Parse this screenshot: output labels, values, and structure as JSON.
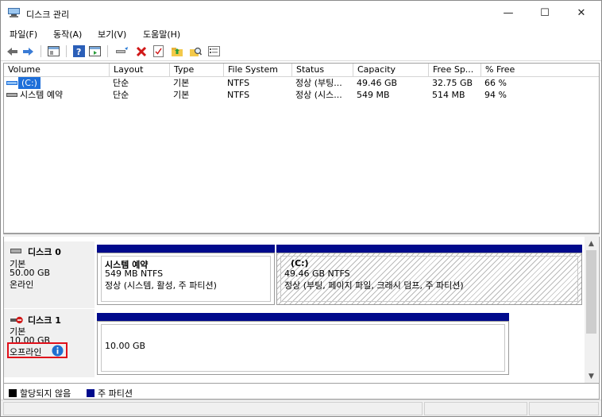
{
  "window": {
    "title": "디스크 관리",
    "minimize_glyph": "—",
    "maximize_glyph": "☐",
    "close_glyph": "✕"
  },
  "menu": [
    "파일(F)",
    "동작(A)",
    "보기(V)",
    "도움말(H)"
  ],
  "toolbar_icons": [
    "back-icon",
    "forward-icon",
    "console-tree-icon",
    "help-icon",
    "show-hide-icon",
    "connect-icon",
    "delete-icon",
    "checklist-icon",
    "folder-up-icon",
    "search-icon",
    "properties-icon"
  ],
  "volume_list": {
    "columns": [
      "Volume",
      "Layout",
      "Type",
      "File System",
      "Status",
      "Capacity",
      "Free Sp...",
      "% Free"
    ],
    "rows": [
      {
        "volume": "(C:)",
        "layout": "단순",
        "type": "기본",
        "fs": "NTFS",
        "status": "정상 (부팅...",
        "capacity": "49.46 GB",
        "free": "32.75 GB",
        "pct": "66 %"
      },
      {
        "volume": "시스템 예약",
        "layout": "단순",
        "type": "기본",
        "fs": "NTFS",
        "status": "정상 (시스...",
        "capacity": "549 MB",
        "free": "514 MB",
        "pct": "94 %"
      }
    ]
  },
  "disks": [
    {
      "name": "디스크 0",
      "type": "기본",
      "size": "50.00 GB",
      "state": "온라인",
      "partitions": [
        {
          "name": "시스템 예약",
          "size": "549 MB NTFS",
          "status": "정상 (시스템, 활성, 주 파티션)"
        },
        {
          "name": "(C:)",
          "size": "49.46 GB NTFS",
          "status": "정상 (부팅, 페이지 파일, 크래시 덤프, 주 파티션)"
        }
      ]
    },
    {
      "name": "디스크 1",
      "type": "기본",
      "size": "10.00 GB",
      "state": "오프라인",
      "partitions": [
        {
          "name": "",
          "size": "10.00 GB",
          "status": ""
        }
      ]
    }
  ],
  "legend": {
    "unallocated": "할당되지 않음",
    "primary": "주 파티션",
    "unallocated_color": "#000000",
    "primary_color": "#000a8c"
  }
}
